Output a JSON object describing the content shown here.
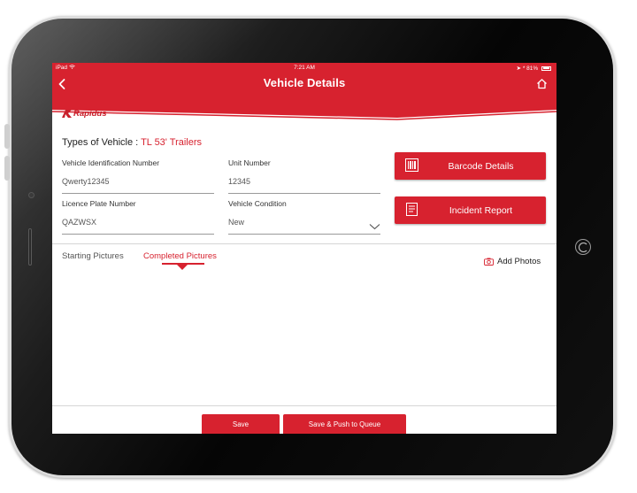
{
  "status_bar": {
    "device": "iPad",
    "time": "7:21 AM",
    "battery": "81%"
  },
  "nav": {
    "title": "Vehicle Details",
    "back_icon": "chevron-left-icon",
    "home_icon": "home-icon"
  },
  "brand": {
    "name": "Rapidus"
  },
  "vehicle_type": {
    "label": "Types of Vehicle :",
    "value": "TL 53' Trailers"
  },
  "form": {
    "vin": {
      "label": "Vehicle Identification Number",
      "value": "Qwerty12345"
    },
    "unit_number": {
      "label": "Unit Number",
      "value": "12345"
    },
    "licence_plate": {
      "label": "Licence Plate Number",
      "value": "QAZWSX"
    },
    "condition": {
      "label": "Vehicle Condition",
      "value": "New"
    }
  },
  "actions": {
    "barcode": {
      "label": "Barcode Details",
      "icon": "barcode-icon"
    },
    "incident": {
      "label": "Incident Report",
      "icon": "document-icon"
    }
  },
  "tabs": [
    {
      "label": "Starting Pictures",
      "active": false
    },
    {
      "label": "Completed Pictures",
      "active": true
    }
  ],
  "add_photos": {
    "label": "Add Photos",
    "icon": "camera-icon"
  },
  "footer": {
    "save": "Save",
    "save_push": "Save & Push to Queue"
  },
  "colors": {
    "brand_red": "#d7222f",
    "background": "#ffffff",
    "band_gray": "#f3f3f3"
  }
}
